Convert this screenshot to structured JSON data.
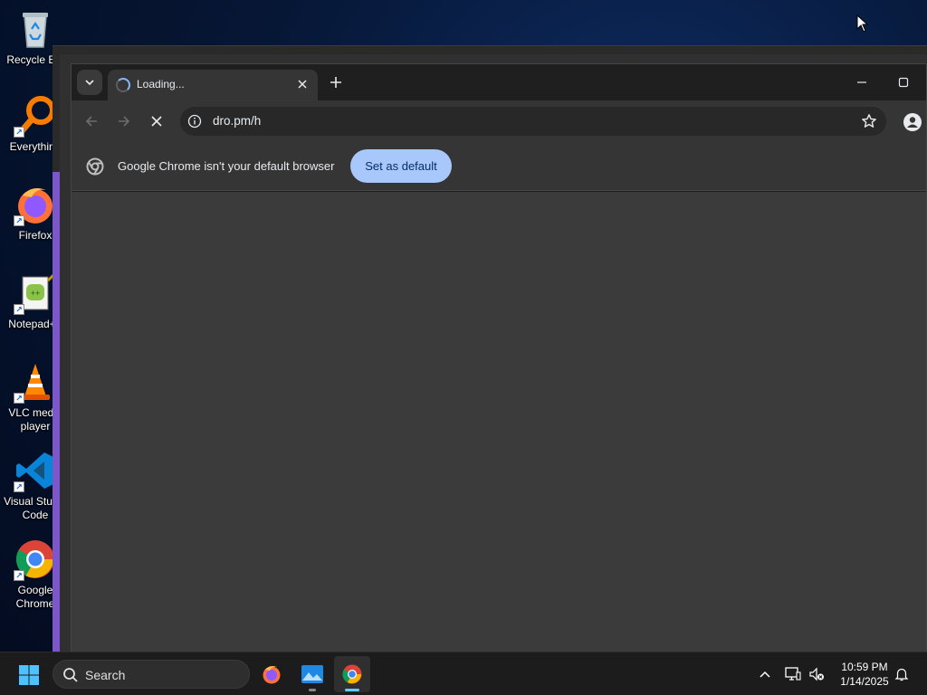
{
  "desktop": {
    "icons": [
      {
        "label": "Recycle Bin"
      },
      {
        "label": "Everything"
      },
      {
        "label": "Firefox"
      },
      {
        "label": "Notepad++"
      },
      {
        "label": "VLC media player"
      },
      {
        "label": "Visual Studio Code"
      },
      {
        "label": "Google Chrome"
      }
    ]
  },
  "browser": {
    "tab": {
      "title": "Loading..."
    },
    "address": {
      "url": "dro.pm/h"
    },
    "infobar": {
      "message": "Google Chrome isn't your default browser",
      "button": "Set as default"
    }
  },
  "taskbar": {
    "search_label": "Search",
    "clock": {
      "time": "10:59 PM",
      "date": "1/14/2025"
    }
  },
  "colors": {
    "accent": "#a8c7fa",
    "tab_spinner": "#8ab4f8",
    "taskbar_active": "#60cdff"
  }
}
